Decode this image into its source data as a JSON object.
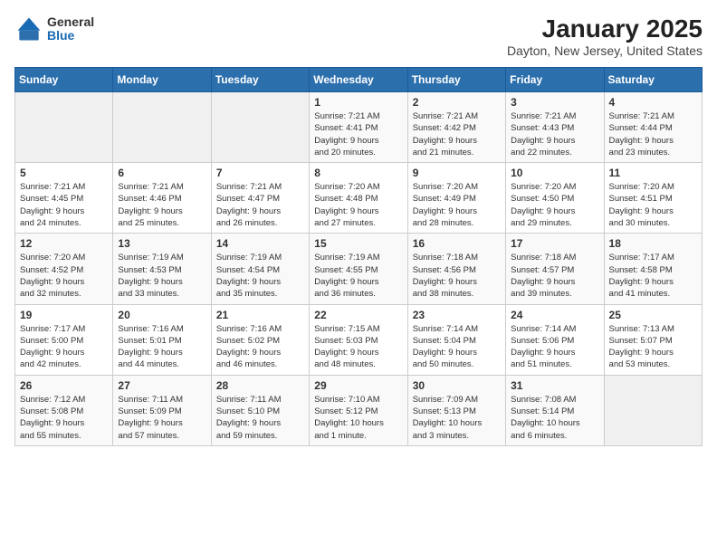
{
  "header": {
    "logo_general": "General",
    "logo_blue": "Blue",
    "title": "January 2025",
    "subtitle": "Dayton, New Jersey, United States"
  },
  "days_of_week": [
    "Sunday",
    "Monday",
    "Tuesday",
    "Wednesday",
    "Thursday",
    "Friday",
    "Saturday"
  ],
  "weeks": [
    [
      {
        "day": "",
        "info": ""
      },
      {
        "day": "",
        "info": ""
      },
      {
        "day": "",
        "info": ""
      },
      {
        "day": "1",
        "info": "Sunrise: 7:21 AM\nSunset: 4:41 PM\nDaylight: 9 hours\nand 20 minutes."
      },
      {
        "day": "2",
        "info": "Sunrise: 7:21 AM\nSunset: 4:42 PM\nDaylight: 9 hours\nand 21 minutes."
      },
      {
        "day": "3",
        "info": "Sunrise: 7:21 AM\nSunset: 4:43 PM\nDaylight: 9 hours\nand 22 minutes."
      },
      {
        "day": "4",
        "info": "Sunrise: 7:21 AM\nSunset: 4:44 PM\nDaylight: 9 hours\nand 23 minutes."
      }
    ],
    [
      {
        "day": "5",
        "info": "Sunrise: 7:21 AM\nSunset: 4:45 PM\nDaylight: 9 hours\nand 24 minutes."
      },
      {
        "day": "6",
        "info": "Sunrise: 7:21 AM\nSunset: 4:46 PM\nDaylight: 9 hours\nand 25 minutes."
      },
      {
        "day": "7",
        "info": "Sunrise: 7:21 AM\nSunset: 4:47 PM\nDaylight: 9 hours\nand 26 minutes."
      },
      {
        "day": "8",
        "info": "Sunrise: 7:20 AM\nSunset: 4:48 PM\nDaylight: 9 hours\nand 27 minutes."
      },
      {
        "day": "9",
        "info": "Sunrise: 7:20 AM\nSunset: 4:49 PM\nDaylight: 9 hours\nand 28 minutes."
      },
      {
        "day": "10",
        "info": "Sunrise: 7:20 AM\nSunset: 4:50 PM\nDaylight: 9 hours\nand 29 minutes."
      },
      {
        "day": "11",
        "info": "Sunrise: 7:20 AM\nSunset: 4:51 PM\nDaylight: 9 hours\nand 30 minutes."
      }
    ],
    [
      {
        "day": "12",
        "info": "Sunrise: 7:20 AM\nSunset: 4:52 PM\nDaylight: 9 hours\nand 32 minutes."
      },
      {
        "day": "13",
        "info": "Sunrise: 7:19 AM\nSunset: 4:53 PM\nDaylight: 9 hours\nand 33 minutes."
      },
      {
        "day": "14",
        "info": "Sunrise: 7:19 AM\nSunset: 4:54 PM\nDaylight: 9 hours\nand 35 minutes."
      },
      {
        "day": "15",
        "info": "Sunrise: 7:19 AM\nSunset: 4:55 PM\nDaylight: 9 hours\nand 36 minutes."
      },
      {
        "day": "16",
        "info": "Sunrise: 7:18 AM\nSunset: 4:56 PM\nDaylight: 9 hours\nand 38 minutes."
      },
      {
        "day": "17",
        "info": "Sunrise: 7:18 AM\nSunset: 4:57 PM\nDaylight: 9 hours\nand 39 minutes."
      },
      {
        "day": "18",
        "info": "Sunrise: 7:17 AM\nSunset: 4:58 PM\nDaylight: 9 hours\nand 41 minutes."
      }
    ],
    [
      {
        "day": "19",
        "info": "Sunrise: 7:17 AM\nSunset: 5:00 PM\nDaylight: 9 hours\nand 42 minutes."
      },
      {
        "day": "20",
        "info": "Sunrise: 7:16 AM\nSunset: 5:01 PM\nDaylight: 9 hours\nand 44 minutes."
      },
      {
        "day": "21",
        "info": "Sunrise: 7:16 AM\nSunset: 5:02 PM\nDaylight: 9 hours\nand 46 minutes."
      },
      {
        "day": "22",
        "info": "Sunrise: 7:15 AM\nSunset: 5:03 PM\nDaylight: 9 hours\nand 48 minutes."
      },
      {
        "day": "23",
        "info": "Sunrise: 7:14 AM\nSunset: 5:04 PM\nDaylight: 9 hours\nand 50 minutes."
      },
      {
        "day": "24",
        "info": "Sunrise: 7:14 AM\nSunset: 5:06 PM\nDaylight: 9 hours\nand 51 minutes."
      },
      {
        "day": "25",
        "info": "Sunrise: 7:13 AM\nSunset: 5:07 PM\nDaylight: 9 hours\nand 53 minutes."
      }
    ],
    [
      {
        "day": "26",
        "info": "Sunrise: 7:12 AM\nSunset: 5:08 PM\nDaylight: 9 hours\nand 55 minutes."
      },
      {
        "day": "27",
        "info": "Sunrise: 7:11 AM\nSunset: 5:09 PM\nDaylight: 9 hours\nand 57 minutes."
      },
      {
        "day": "28",
        "info": "Sunrise: 7:11 AM\nSunset: 5:10 PM\nDaylight: 9 hours\nand 59 minutes."
      },
      {
        "day": "29",
        "info": "Sunrise: 7:10 AM\nSunset: 5:12 PM\nDaylight: 10 hours\nand 1 minute."
      },
      {
        "day": "30",
        "info": "Sunrise: 7:09 AM\nSunset: 5:13 PM\nDaylight: 10 hours\nand 3 minutes."
      },
      {
        "day": "31",
        "info": "Sunrise: 7:08 AM\nSunset: 5:14 PM\nDaylight: 10 hours\nand 6 minutes."
      },
      {
        "day": "",
        "info": ""
      }
    ]
  ]
}
